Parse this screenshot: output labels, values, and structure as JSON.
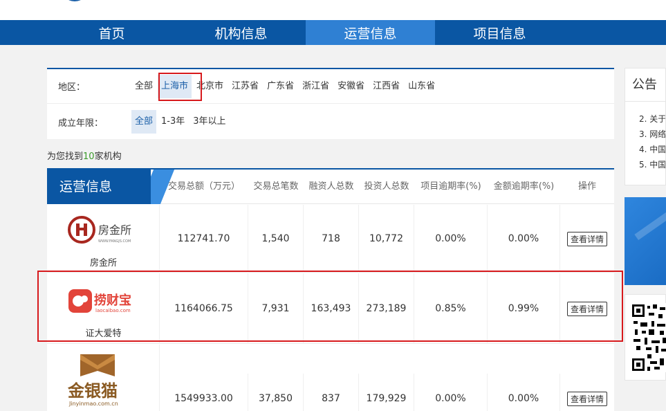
{
  "nav": {
    "items": [
      {
        "label": "首页"
      },
      {
        "label": "机构信息"
      },
      {
        "label": "运营信息"
      },
      {
        "label": "项目信息"
      }
    ],
    "active_index": 2
  },
  "filters": {
    "region_label": "地区：",
    "region_options": [
      "全部",
      "上海市",
      "北京市",
      "江苏省",
      "广东省",
      "浙江省",
      "安徽省",
      "江西省",
      "山东省"
    ],
    "region_selected": "上海市",
    "years_label": "成立年限：",
    "years_options": [
      "全部",
      "1-3年",
      "3年以上"
    ],
    "years_selected": "全部"
  },
  "result": {
    "prefix": "为您找到",
    "count": "10",
    "suffix": "家机构"
  },
  "table": {
    "title": "运营信息",
    "headers": [
      "交易总额（万元）",
      "交易总笔数",
      "融资人总数",
      "投资人总数",
      "项目逾期率(%)",
      "金额逾期率(%)",
      "操作"
    ],
    "rows": [
      {
        "name": "房金所",
        "logo_text": "房金所",
        "logo_sub": "WWW.FANGJS.COM",
        "cells": [
          "112741.70",
          "1,540",
          "718",
          "10,772",
          "0.00%",
          "0.00%"
        ],
        "action": "查看详情"
      },
      {
        "name": "证大爱特",
        "logo_text": "捞财宝",
        "logo_sub": "laocaibao.com",
        "cells": [
          "1164066.75",
          "7,931",
          "163,493",
          "273,189",
          "0.85%",
          "0.99%"
        ],
        "action": "查看详情"
      },
      {
        "name": "",
        "logo_text": "金银猫",
        "logo_sub": "Jinyinmao.com.cn",
        "cells": [
          "1549933.00",
          "37,850",
          "837",
          "179,929",
          "0.00%",
          "0.00%"
        ],
        "action": "查看详情"
      }
    ]
  },
  "sidebar": {
    "notice_title": "公告",
    "notice_items": [
      "2. 关于",
      "3. 网络",
      "4. 中国",
      "5. 中国"
    ]
  },
  "colors": {
    "nav_bg": "#0a56a3",
    "nav_active": "#2f80d3",
    "highlight_red": "#d7191c",
    "count_green": "#3a9a2a"
  }
}
